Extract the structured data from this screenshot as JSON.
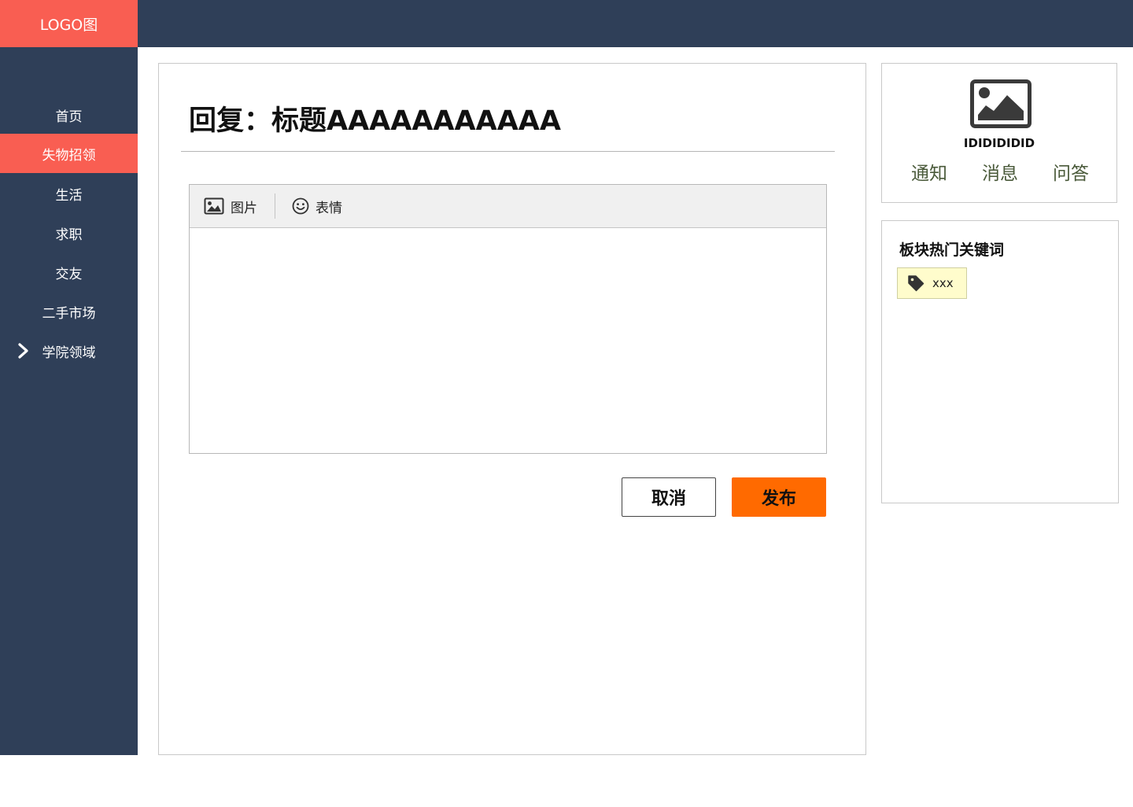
{
  "header": {
    "logo_text": "LOGO图"
  },
  "sidebar": {
    "items": [
      {
        "label": "首页"
      },
      {
        "label": "失物招领",
        "active": true
      },
      {
        "label": "生活"
      },
      {
        "label": "求职"
      },
      {
        "label": "交友"
      },
      {
        "label": "二手市场"
      },
      {
        "label": "学院领域",
        "has_chevron": true
      }
    ]
  },
  "main": {
    "title": "回复：标题AAAAAAAAAAA",
    "toolbar": {
      "image_label": "图片",
      "emoji_label": "表情"
    },
    "editor": {
      "value": ""
    },
    "buttons": {
      "cancel": "取消",
      "publish": "发布"
    }
  },
  "user_card": {
    "user_id": "IDIDIDIDID",
    "links": [
      "通知",
      "消息",
      "问答"
    ]
  },
  "keywords": {
    "title": "板块热门关键词",
    "tags": [
      "xxx"
    ]
  },
  "colors": {
    "nav_bg": "#2f3f58",
    "accent": "#f95e52",
    "publish": "#ff6a00",
    "tag_bg": "#fffccc"
  },
  "icons": [
    "image-icon",
    "smiley-icon",
    "chevron-right-icon",
    "tag-icon",
    "avatar-image-icon"
  ]
}
